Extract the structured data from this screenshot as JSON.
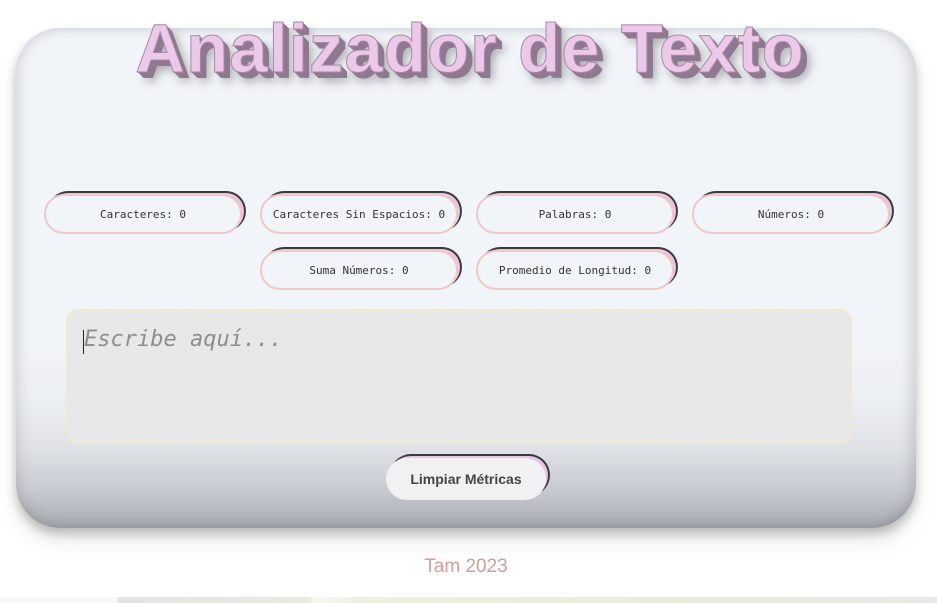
{
  "app": {
    "title": "Analizador de Texto"
  },
  "metrics": [
    {
      "label": "Caracteres: 0"
    },
    {
      "label": "Caracteres Sin Espacios: 0"
    },
    {
      "label": "Palabras: 0"
    },
    {
      "label": "Números: 0"
    },
    {
      "label": "Suma Números: 0"
    },
    {
      "label": "Promedio de Longitud: 0"
    }
  ],
  "input": {
    "value": "",
    "placeholder": "Escribe aquí..."
  },
  "actions": {
    "clear_label": "Limpiar Métricas"
  },
  "footer": {
    "text": "Tam 2023"
  },
  "colors": {
    "title_fill": "#ecc8e9",
    "pill_border": "#f0c6c6",
    "footer_text": "#d49b9f",
    "textarea_bg": "#e8e8e8",
    "textarea_border": "#f3ebc0"
  }
}
